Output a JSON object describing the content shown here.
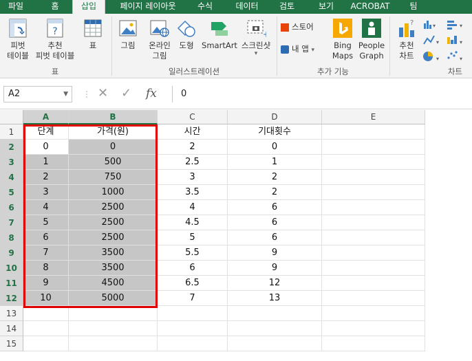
{
  "ribbon": {
    "tabs": [
      "파일",
      "홈",
      "삽입",
      "페이지 레이아웃",
      "수식",
      "데이터",
      "검토",
      "보기",
      "ACROBAT",
      "팀"
    ],
    "active_tab": "삽입",
    "buttons": {
      "pivot_table": "피벗\n테이블",
      "recommended_pivot": "추천\n피벗 테이블",
      "table": "표",
      "picture": "그림",
      "online_picture": "온라인\n그림",
      "shapes": "도형",
      "smartart": "SmartArt",
      "screenshot": "스크린샷",
      "store": "스토어",
      "my_apps": "내 앱",
      "bing_maps": "Bing\nMaps",
      "people_graph": "People\nGraph",
      "recommended_charts": "추천\n차트"
    },
    "groups": {
      "tables": "표",
      "illustrations": "일러스트레이션",
      "addins": "추가 기능",
      "charts": "차트"
    },
    "colors": {
      "tab_bar": "#217346",
      "store_icon": "#e8430b",
      "bing_icon": "#f7a800",
      "people_icon": "#217346",
      "highlight_border": "#e00000"
    }
  },
  "formula_bar": {
    "name_box": "A2",
    "fx_label": "fx",
    "value": "0"
  },
  "sheet": {
    "columns": [
      "A",
      "B",
      "C",
      "D",
      "E"
    ],
    "row_numbers": [
      "1",
      "2",
      "3",
      "4",
      "5",
      "6",
      "7",
      "8",
      "9",
      "10",
      "11",
      "12",
      "13",
      "14",
      "15"
    ],
    "header": [
      "단계",
      "가격(원)",
      "시간",
      "기대횟수"
    ],
    "rows": [
      [
        "0",
        "0",
        "2",
        "0"
      ],
      [
        "1",
        "500",
        "2.5",
        "1"
      ],
      [
        "2",
        "750",
        "3",
        "2"
      ],
      [
        "3",
        "1000",
        "3.5",
        "2"
      ],
      [
        "4",
        "2500",
        "4",
        "6"
      ],
      [
        "5",
        "2500",
        "4.5",
        "6"
      ],
      [
        "6",
        "2500",
        "5",
        "6"
      ],
      [
        "7",
        "3500",
        "5.5",
        "9"
      ],
      [
        "8",
        "3500",
        "6",
        "9"
      ],
      [
        "9",
        "4500",
        "6.5",
        "12"
      ],
      [
        "10",
        "5000",
        "7",
        "13"
      ]
    ],
    "selection": "A2:B12"
  }
}
